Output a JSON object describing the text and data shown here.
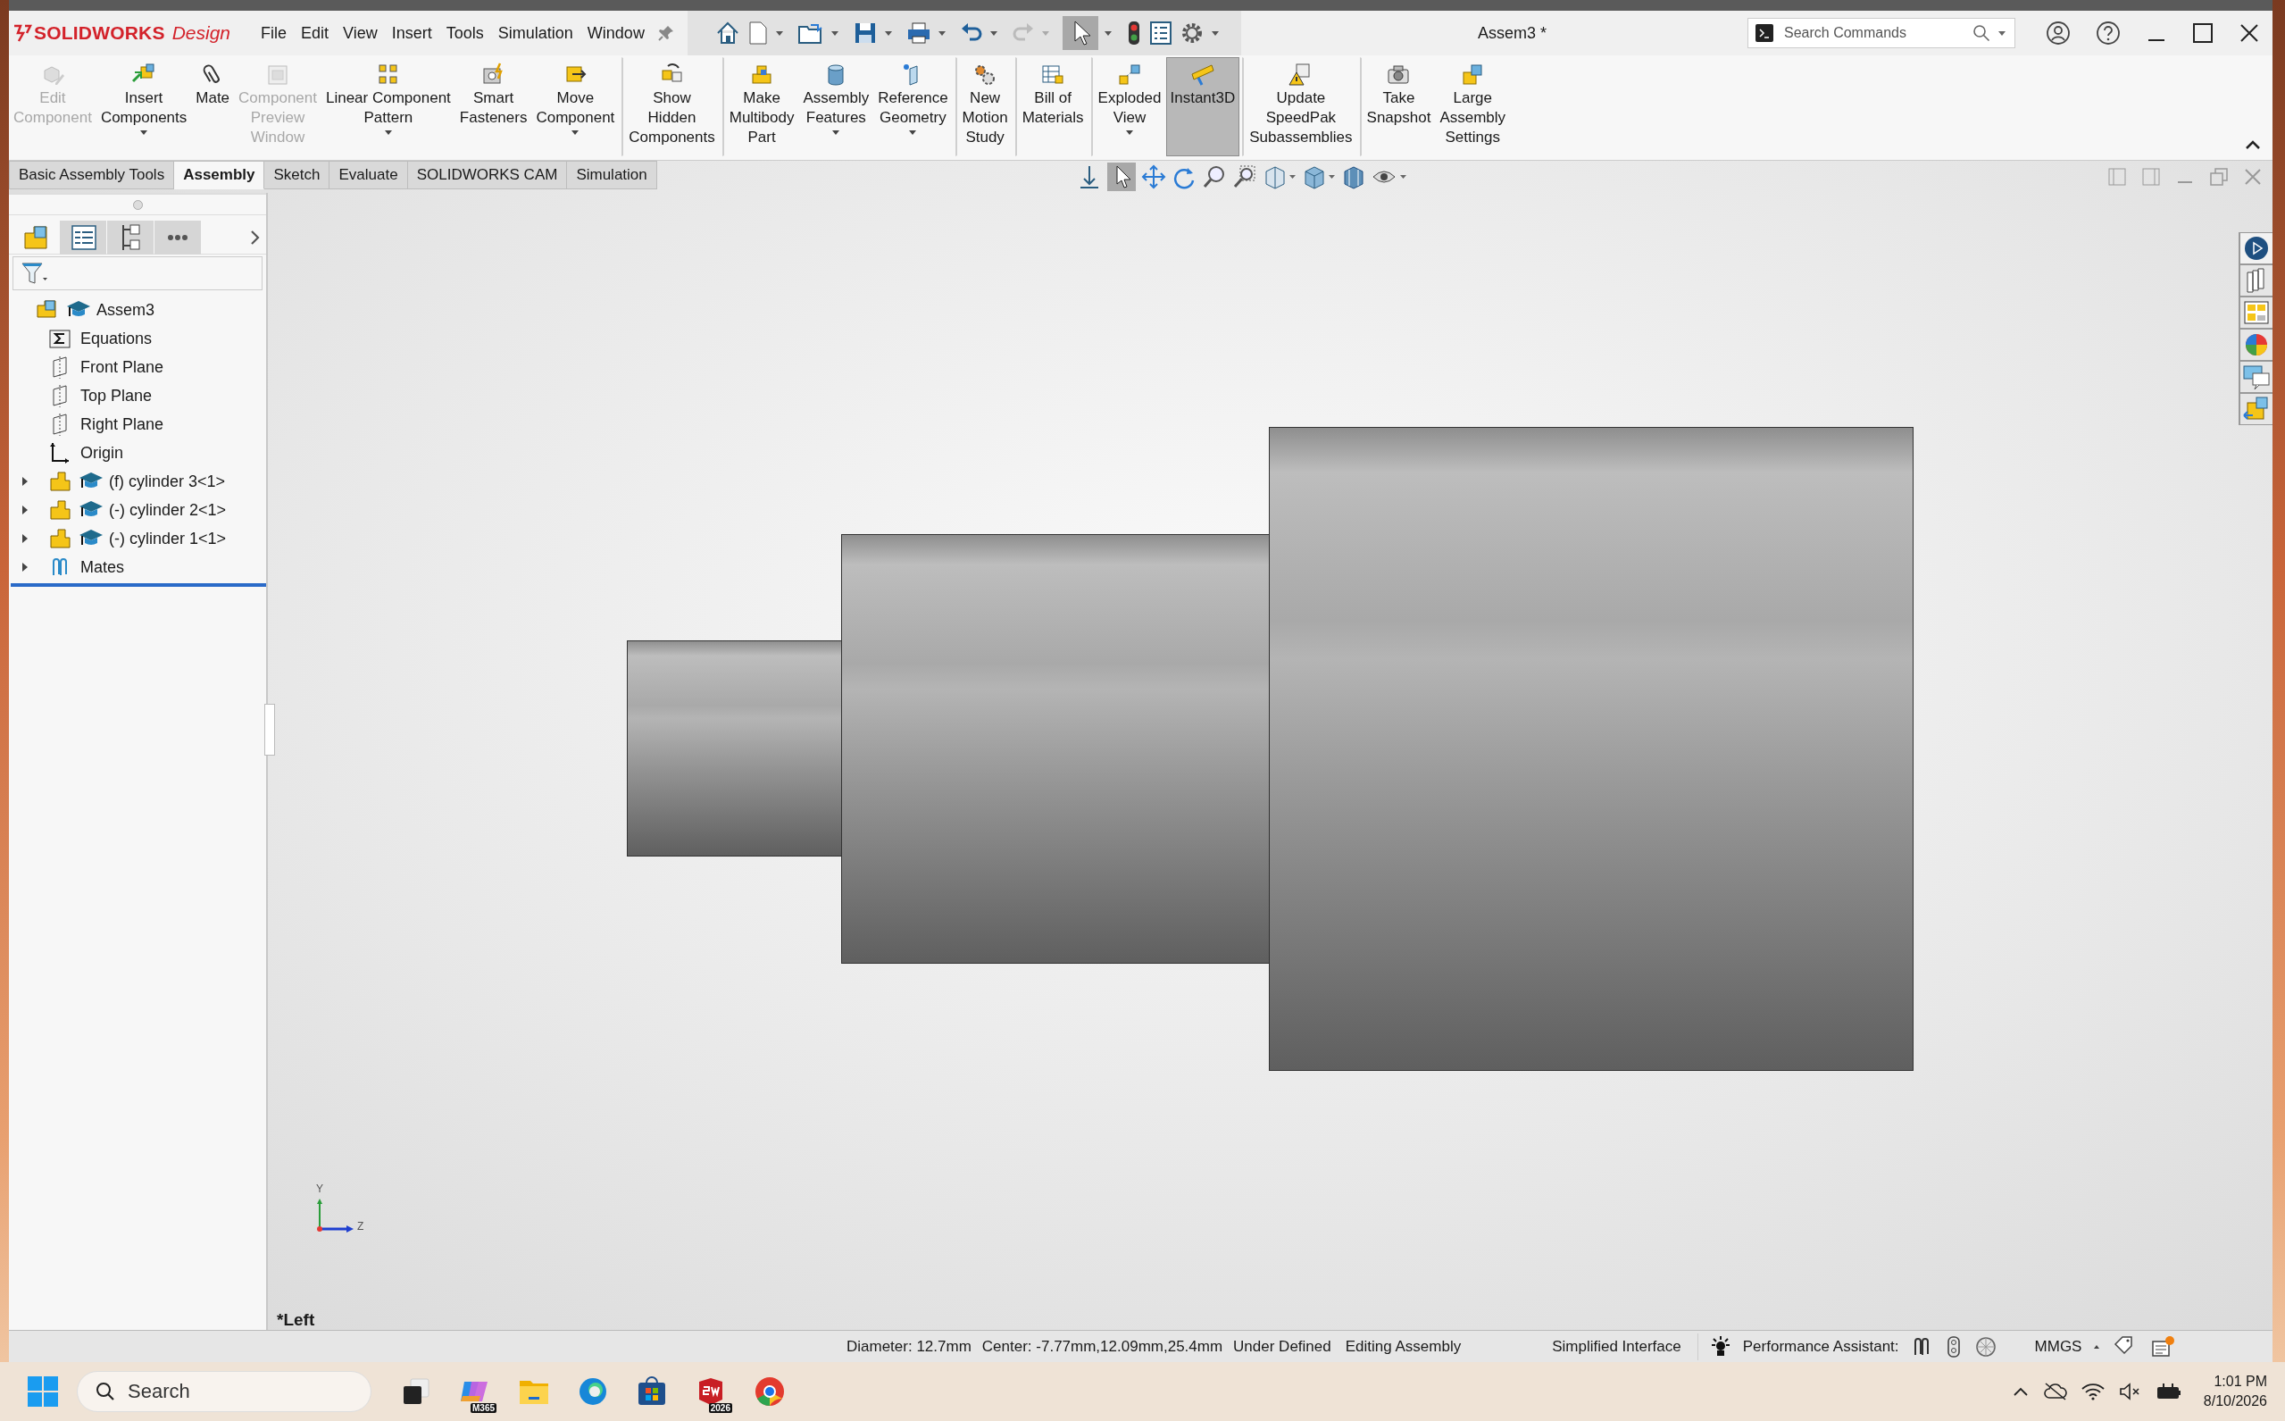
{
  "logo": {
    "brand": "SOLIDWORKS",
    "product": "Design"
  },
  "menu": [
    {
      "label": "File"
    },
    {
      "label": "Edit"
    },
    {
      "label": "View"
    },
    {
      "label": "Insert"
    },
    {
      "label": "Tools"
    },
    {
      "label": "Simulation"
    },
    {
      "label": "Window"
    }
  ],
  "title": "Assem3 *",
  "search": {
    "placeholder": "Search Commands"
  },
  "ribbon": [
    {
      "lines": [
        "Edit",
        "Component"
      ],
      "disabled": true,
      "dropdown": false,
      "selected": false,
      "group_start": false
    },
    {
      "lines": [
        "Insert",
        "Components"
      ],
      "disabled": false,
      "dropdown": true,
      "selected": false,
      "group_start": false
    },
    {
      "lines": [
        "Mate"
      ],
      "disabled": false,
      "dropdown": false,
      "selected": false,
      "group_start": false
    },
    {
      "lines": [
        "Component",
        "Preview",
        "Window"
      ],
      "disabled": true,
      "dropdown": false,
      "selected": false,
      "group_start": false
    },
    {
      "lines": [
        "Linear Component",
        "Pattern"
      ],
      "disabled": false,
      "dropdown": true,
      "selected": false,
      "group_start": false
    },
    {
      "lines": [
        "Smart",
        "Fasteners"
      ],
      "disabled": false,
      "dropdown": false,
      "selected": false,
      "group_start": false
    },
    {
      "lines": [
        "Move",
        "Component"
      ],
      "disabled": false,
      "dropdown": true,
      "selected": false,
      "group_start": false
    },
    {
      "lines": [
        "Show",
        "Hidden",
        "Components"
      ],
      "disabled": false,
      "dropdown": false,
      "selected": false,
      "group_start": true
    },
    {
      "lines": [
        "Make",
        "Multibody",
        "Part"
      ],
      "disabled": false,
      "dropdown": false,
      "selected": false,
      "group_start": true
    },
    {
      "lines": [
        "Assembly",
        "Features"
      ],
      "disabled": false,
      "dropdown": true,
      "selected": false,
      "group_start": false
    },
    {
      "lines": [
        "Reference",
        "Geometry"
      ],
      "disabled": false,
      "dropdown": true,
      "selected": false,
      "group_start": false
    },
    {
      "lines": [
        "New",
        "Motion",
        "Study"
      ],
      "disabled": false,
      "dropdown": false,
      "selected": false,
      "group_start": true
    },
    {
      "lines": [
        "Bill of",
        "Materials"
      ],
      "disabled": false,
      "dropdown": false,
      "selected": false,
      "group_start": true
    },
    {
      "lines": [
        "Exploded",
        "View"
      ],
      "disabled": false,
      "dropdown": true,
      "selected": false,
      "group_start": true
    },
    {
      "lines": [
        "Instant3D"
      ],
      "disabled": false,
      "dropdown": false,
      "selected": true,
      "group_start": false
    },
    {
      "lines": [
        "Update",
        "SpeedPak",
        "Subassemblies"
      ],
      "disabled": false,
      "dropdown": false,
      "selected": false,
      "group_start": true
    },
    {
      "lines": [
        "Take",
        "Snapshot"
      ],
      "disabled": false,
      "dropdown": false,
      "selected": false,
      "group_start": true
    },
    {
      "lines": [
        "Large",
        "Assembly",
        "Settings"
      ],
      "disabled": false,
      "dropdown": false,
      "selected": false,
      "group_start": false
    }
  ],
  "tabs": [
    {
      "label": "Basic Assembly Tools",
      "selected": false
    },
    {
      "label": "Assembly",
      "selected": true
    },
    {
      "label": "Sketch",
      "selected": false
    },
    {
      "label": "Evaluate",
      "selected": false
    },
    {
      "label": "SOLIDWORKS CAM",
      "selected": false
    },
    {
      "label": "Simulation",
      "selected": false
    }
  ],
  "tree": {
    "label": "Assem3",
    "kind": "assembly",
    "children": [
      {
        "label": "Equations",
        "kind": "equations"
      },
      {
        "label": "Front Plane",
        "kind": "plane"
      },
      {
        "label": "Top Plane",
        "kind": "plane"
      },
      {
        "label": "Right Plane",
        "kind": "plane"
      },
      {
        "label": "Origin",
        "kind": "origin"
      },
      {
        "label": "(f) cylinder 3<1>",
        "kind": "part",
        "expanded": false
      },
      {
        "label": "(-) cylinder 2<1>",
        "kind": "part",
        "expanded": false
      },
      {
        "label": "(-) cylinder 1<1>",
        "kind": "part",
        "expanded": false
      },
      {
        "label": "Mates",
        "kind": "mates",
        "expanded": false
      }
    ]
  },
  "view_label": "*Left",
  "triad": {
    "y": "Y",
    "z": "Z"
  },
  "status_bar": {
    "items": [
      "Diameter: 12.7mm",
      "Center: -7.77mm,12.09mm,25.4mm",
      "Under Defined",
      "Editing Assembly",
      "Simplified Interface"
    ],
    "performance_label": "Performance Assistant:",
    "units": "MMGS"
  },
  "taskbar": {
    "search_placeholder": "Search",
    "apps": [
      {
        "kind": "task-view"
      },
      {
        "kind": "copilot",
        "badge": "M365"
      },
      {
        "kind": "explorer"
      },
      {
        "kind": "edge"
      },
      {
        "kind": "store"
      },
      {
        "kind": "solidworks",
        "badge": "2026"
      },
      {
        "kind": "chrome"
      }
    ],
    "time": "1:01 PM",
    "date": "8/10/2026"
  }
}
